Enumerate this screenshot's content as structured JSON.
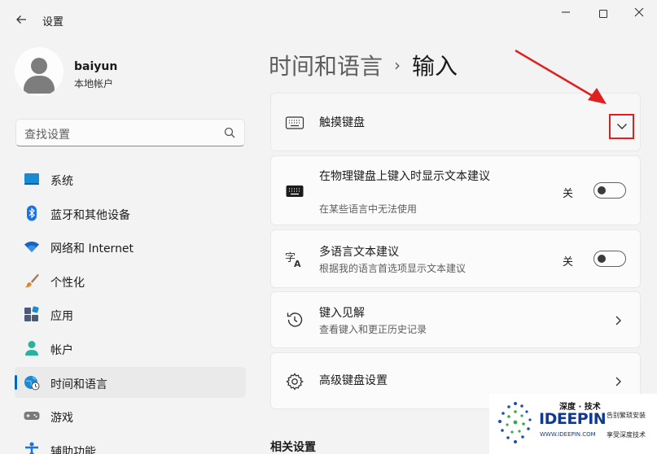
{
  "window": {
    "title": "设置",
    "back_icon": "arrow-left-icon",
    "controls": [
      "minimize",
      "maximize",
      "close"
    ]
  },
  "profile": {
    "name": "baiyun",
    "account_type": "本地帐户"
  },
  "search": {
    "placeholder": "查找设置",
    "icon": "search-icon"
  },
  "sidebar": {
    "items": [
      {
        "label": "系统",
        "icon": "system-icon",
        "color": "#1a8ad4"
      },
      {
        "label": "蓝牙和其他设备",
        "icon": "bluetooth-icon",
        "color": "#1a73e8"
      },
      {
        "label": "网络和 Internet",
        "icon": "wifi-icon",
        "color": "#1565c0"
      },
      {
        "label": "个性化",
        "icon": "brush-icon",
        "color": "#e08a2e"
      },
      {
        "label": "应用",
        "icon": "apps-icon",
        "color": "#4a5a78"
      },
      {
        "label": "帐户",
        "icon": "account-icon",
        "color": "#2bb29a"
      },
      {
        "label": "时间和语言",
        "icon": "globe-clock-icon",
        "color": "#1a8ad4",
        "selected": true
      },
      {
        "label": "游戏",
        "icon": "gamepad-icon",
        "color": "#7a7a7a"
      },
      {
        "label": "辅助功能",
        "icon": "accessibility-icon",
        "color": "#1a73e8"
      }
    ]
  },
  "main": {
    "breadcrumb_parent": "时间和语言",
    "breadcrumb_sep": "›",
    "breadcrumb_current": "输入",
    "cards": [
      {
        "title": "触摸键盘",
        "icon": "keyboard-outline-icon",
        "control": "expander"
      },
      {
        "title": "在物理键盘上键入时显示文本建议",
        "subtitle": "在某些语言中无法使用",
        "icon": "keyboard-icon",
        "control": "toggle",
        "state": "关"
      },
      {
        "title": "多语言文本建议",
        "subtitle": "根据我的语言首选项显示文本建议",
        "icon": "language-icon",
        "control": "toggle",
        "state": "关"
      },
      {
        "title": "键入见解",
        "subtitle": "查看键入和更正历史记录",
        "icon": "history-icon",
        "control": "chevron"
      },
      {
        "title": "高级键盘设置",
        "icon": "gear-icon",
        "control": "chevron"
      }
    ],
    "related_settings": "相关设置"
  },
  "watermark": {
    "cn_title": "深度 · 技术",
    "brand": "IDEEPIN",
    "url": "WWW.IDEEPIN.COM",
    "tag1": "告别繁琐安装",
    "tag2": "享受深度技术"
  },
  "colors": {
    "accent": "#0067c0",
    "annotation_red": "#e02020"
  }
}
